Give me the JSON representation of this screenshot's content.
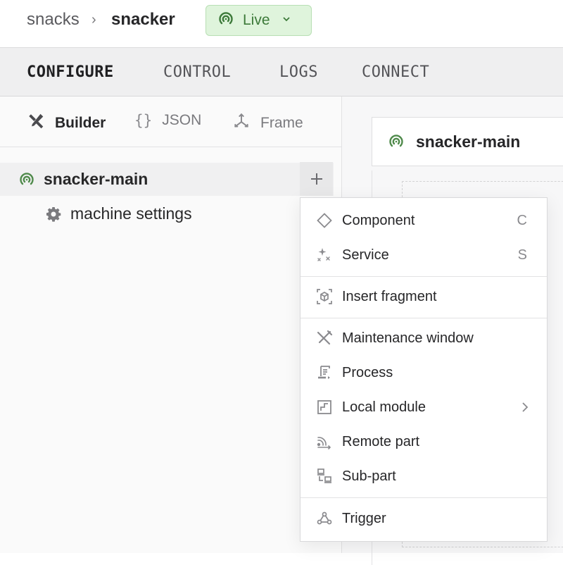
{
  "breadcrumb": {
    "org": "snacks",
    "separator": "›",
    "machine": "snacker"
  },
  "status": {
    "label": "Live",
    "color": "#3d7a3a",
    "background": "#dff4dc"
  },
  "tabs": [
    {
      "label": "CONFIGURE",
      "active": true
    },
    {
      "label": "CONTROL",
      "active": false
    },
    {
      "label": "LOGS",
      "active": false
    },
    {
      "label": "CONNECT",
      "active": false
    }
  ],
  "modes": [
    {
      "label": "Builder",
      "icon": "tools-icon",
      "active": true
    },
    {
      "label": "JSON",
      "icon": "braces-icon",
      "active": false
    },
    {
      "label": "Frame",
      "icon": "axes-icon",
      "active": false
    }
  ],
  "tree": {
    "root": {
      "name": "snacker-main",
      "icon": "online-signal-icon"
    },
    "children": [
      {
        "name": "machine settings",
        "icon": "gear-icon"
      }
    ],
    "add_label": "+"
  },
  "canvas": {
    "node_name": "snacker-main"
  },
  "menu": {
    "groups": [
      [
        {
          "label": "Component",
          "icon": "diamond-icon",
          "shortcut": "C"
        },
        {
          "label": "Service",
          "icon": "sparkle-icon",
          "shortcut": "S"
        }
      ],
      [
        {
          "label": "Insert fragment",
          "icon": "fragment-cube-icon"
        }
      ],
      [
        {
          "label": "Maintenance window",
          "icon": "hammer-wrench-icon"
        },
        {
          "label": "Process",
          "icon": "script-icon"
        },
        {
          "label": "Local module",
          "icon": "module-icon",
          "submenu": true
        },
        {
          "label": "Remote part",
          "icon": "remote-signal-icon"
        },
        {
          "label": "Sub-part",
          "icon": "sub-part-icon"
        }
      ],
      [
        {
          "label": "Trigger",
          "icon": "webhook-icon"
        }
      ]
    ]
  }
}
